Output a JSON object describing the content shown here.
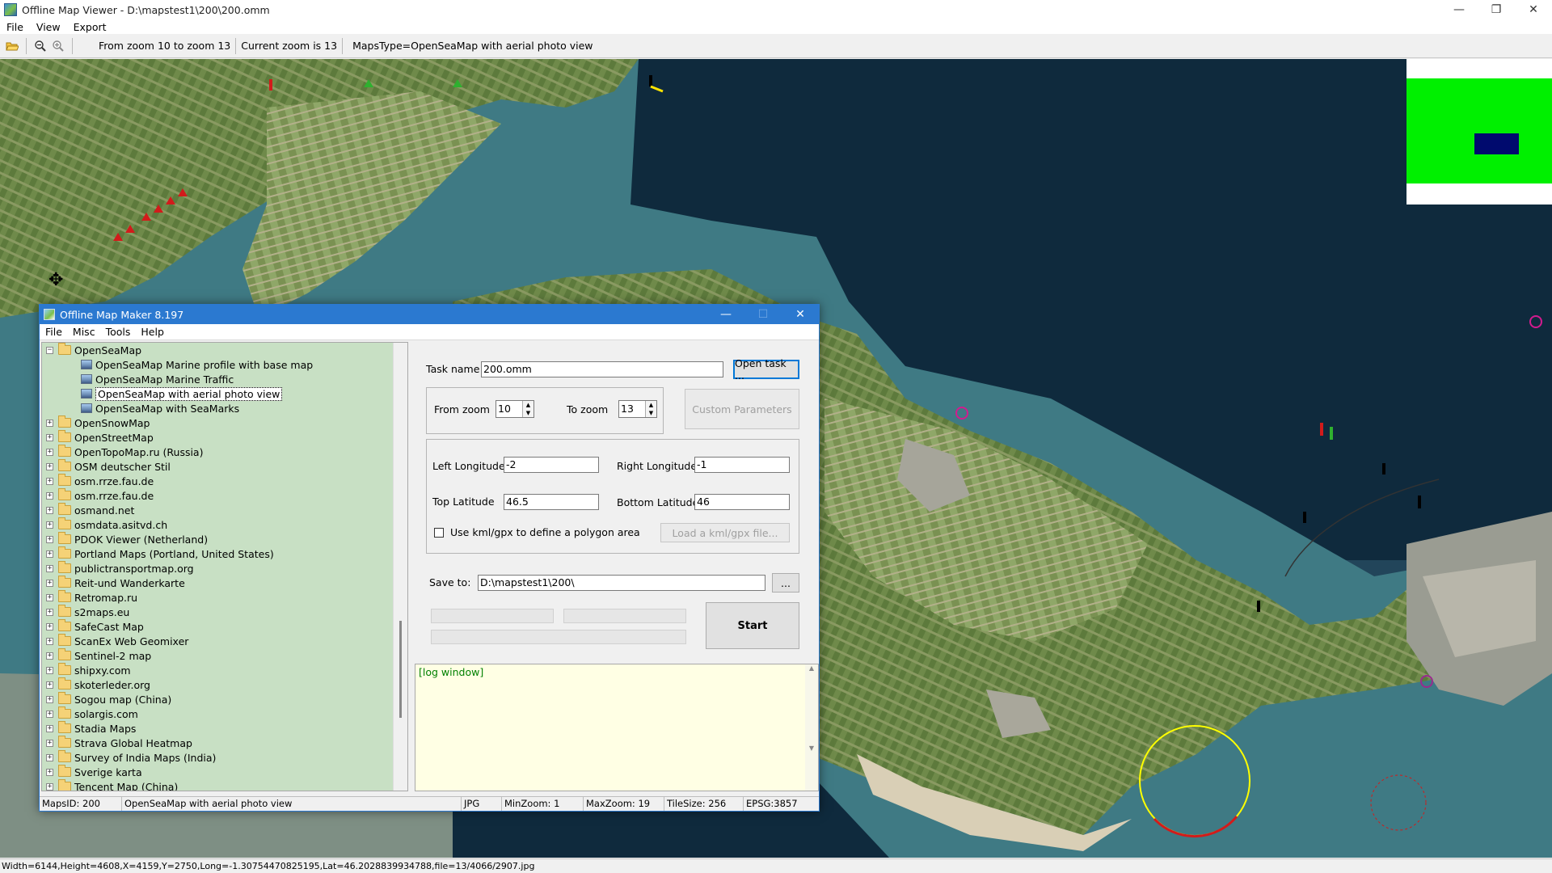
{
  "window": {
    "title": "Offline Map Viewer - D:\\mapstest1\\200\\200.omm",
    "minimize": "—",
    "restore": "❐",
    "close": "✕"
  },
  "menu": [
    "File",
    "View",
    "Export"
  ],
  "toolbar": {
    "zoom_range": "From zoom 10 to zoom 13",
    "current_zoom": "Current zoom is 13",
    "maps_type": "MapsType=OpenSeaMap with aerial photo view"
  },
  "status_bar": "Width=6144,Height=4608,X=4159,Y=2750,Long=-1.30754470825195,Lat=46.2028839934788,file=13/4066/2907.jpg",
  "dialog": {
    "title": "Offline Map Maker 8.197",
    "minimize": "—",
    "maximize": "☐",
    "close": "✕",
    "menu": [
      "File",
      "Misc",
      "Tools",
      "Help"
    ],
    "tree": {
      "root": "OpenSeaMap",
      "children": [
        "OpenSeaMap Marine profile with base map",
        "OpenSeaMap Marine Traffic",
        "OpenSeaMap with aerial photo view",
        "OpenSeaMap with SeaMarks"
      ],
      "selected_child": "OpenSeaMap with aerial photo view",
      "folders": [
        "OpenSnowMap",
        "OpenStreetMap",
        "OpenTopoMap.ru (Russia)",
        "OSM deutscher Stil",
        "osm.rrze.fau.de",
        "osm.rrze.fau.de",
        "osmand.net",
        "osmdata.asitvd.ch",
        "PDOK Viewer (Netherland)",
        "Portland Maps (Portland, United States)",
        "publictransportmap.org",
        "Reit-und Wanderkarte",
        "Retromap.ru",
        "s2maps.eu",
        "SafeCast Map",
        "ScanEx Web Geomixer",
        "Sentinel-2 map",
        "shipxy.com",
        "skoterleder.org",
        "Sogou map (China)",
        "solargis.com",
        "Stadia Maps",
        "Strava Global Heatmap",
        "Survey of India Maps (India)",
        "Sverige karta",
        "Tencent Map (China)"
      ]
    },
    "task_name_label": "Task name",
    "task_name_value": "200.omm",
    "open_task_button": "Open task ...",
    "from_zoom_label": "From zoom",
    "from_zoom_value": "10",
    "to_zoom_label": "To zoom",
    "to_zoom_value": "13",
    "custom_params_button": "Custom Parameters",
    "left_longitude_label": "Left Longitude",
    "left_longitude_value": "-2",
    "right_longitude_label": "Right Longitude",
    "right_longitude_value": "-1",
    "top_latitude_label": "Top Latitude",
    "top_latitude_value": "46.5",
    "bottom_latitude_label": "Bottom Latitude",
    "bottom_latitude_value": "46",
    "kml_checkbox_label": "Use kml/gpx to define a polygon area",
    "load_kml_button": "Load a kml/gpx file...",
    "save_to_label": "Save to:",
    "save_to_value": "D:\\mapstest1\\200\\",
    "browse_button": "...",
    "start_button": "Start",
    "log_text": "[log window]",
    "status": {
      "maps_id": "MapsID: 200",
      "map_name": "OpenSeaMap with aerial photo view",
      "format": "JPG",
      "min_zoom": "MinZoom: 1",
      "max_zoom": "MaxZoom: 19",
      "tile_size": "TileSize: 256",
      "epsg": "EPSG:3857"
    }
  }
}
